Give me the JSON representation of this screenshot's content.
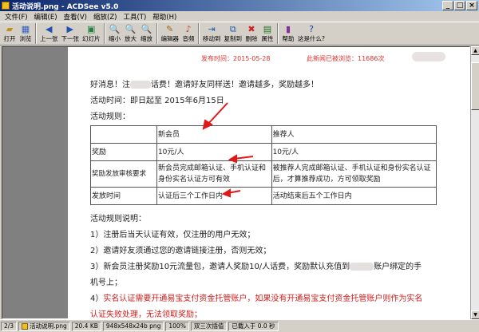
{
  "window": {
    "title": "活动说明.png - ACDSee v5.0",
    "min": "_",
    "max": "□",
    "close": "×"
  },
  "menu": [
    "文件(F)",
    "编辑(E)",
    "查看(V)",
    "缩放(Z)",
    "工具(T)",
    "帮助(H)"
  ],
  "toolbar": {
    "open": "打开",
    "browse": "浏览",
    "prev": "上一张",
    "next": "下一张",
    "slideshow": "幻灯片",
    "zoom_out": "缩小",
    "zoom_in": "放大",
    "zoom": "缩放",
    "editor": "编辑器",
    "audio": "音频",
    "move_to": "移动到",
    "copy_to": "复制到",
    "delete": "删除",
    "properties": "属性",
    "help": "帮助",
    "whats_this": "这是什么?"
  },
  "doc": {
    "published": "发布时间：2015-05-28",
    "reads": "此新闻已被浏览：11686次",
    "intro_a": "好消息！注",
    "intro_b": "话费！邀请好友同样送！邀请越多，奖励越多！",
    "time": "活动时间：即日起至 2015年6月15日",
    "rules_title": "活动规则：",
    "table": {
      "h_new": "新会员",
      "h_ref": "推荐人",
      "r1_label": "奖励",
      "r1_new": "10元/人",
      "r1_ref": "10元/人",
      "r2_label": "奖励发放审核要求",
      "r2_new": "新会员完成邮箱认证、手机认证和身份实名认证方可有效",
      "r2_ref": "被推荐人完成邮箱认证、手机认证和身份实名认证后，才算推荐成功，方可领取奖励",
      "r3_label": "发放时间",
      "r3_new": "认证后三个工作日内",
      "r3_ref": "活动结束后五个工作日内"
    },
    "desc_title": "活动规则说明：",
    "d1": "1）注册后当天认证有效，仅注册的用户无效；",
    "d2": "2）邀请好友须通过您的邀请链接注册，否则无效；",
    "d3a": "3）新会员注册奖励10元流量包，邀请人奖励10/人话费，奖励默认充值到",
    "d3b": "账户绑定的手",
    "d3c": "机号上；",
    "d4a_num": "4）",
    "d4a": "实名认证需要开通易宝支付资金托管账户，如果没有开通易宝支付资金托管账户则作为实名",
    "d4b": "认证失败处理，无法领取奖励；"
  },
  "status": {
    "page": "2/3",
    "file": "活动说明.png",
    "size": "20.4 KB",
    "dims": "948x548x24b png",
    "zoom": "100%",
    "interp": "双三次插值",
    "loaded": "已载入于 0.0 秒"
  },
  "colors": {
    "accent_red": "#d02020",
    "title_blue": "#0a246a"
  }
}
